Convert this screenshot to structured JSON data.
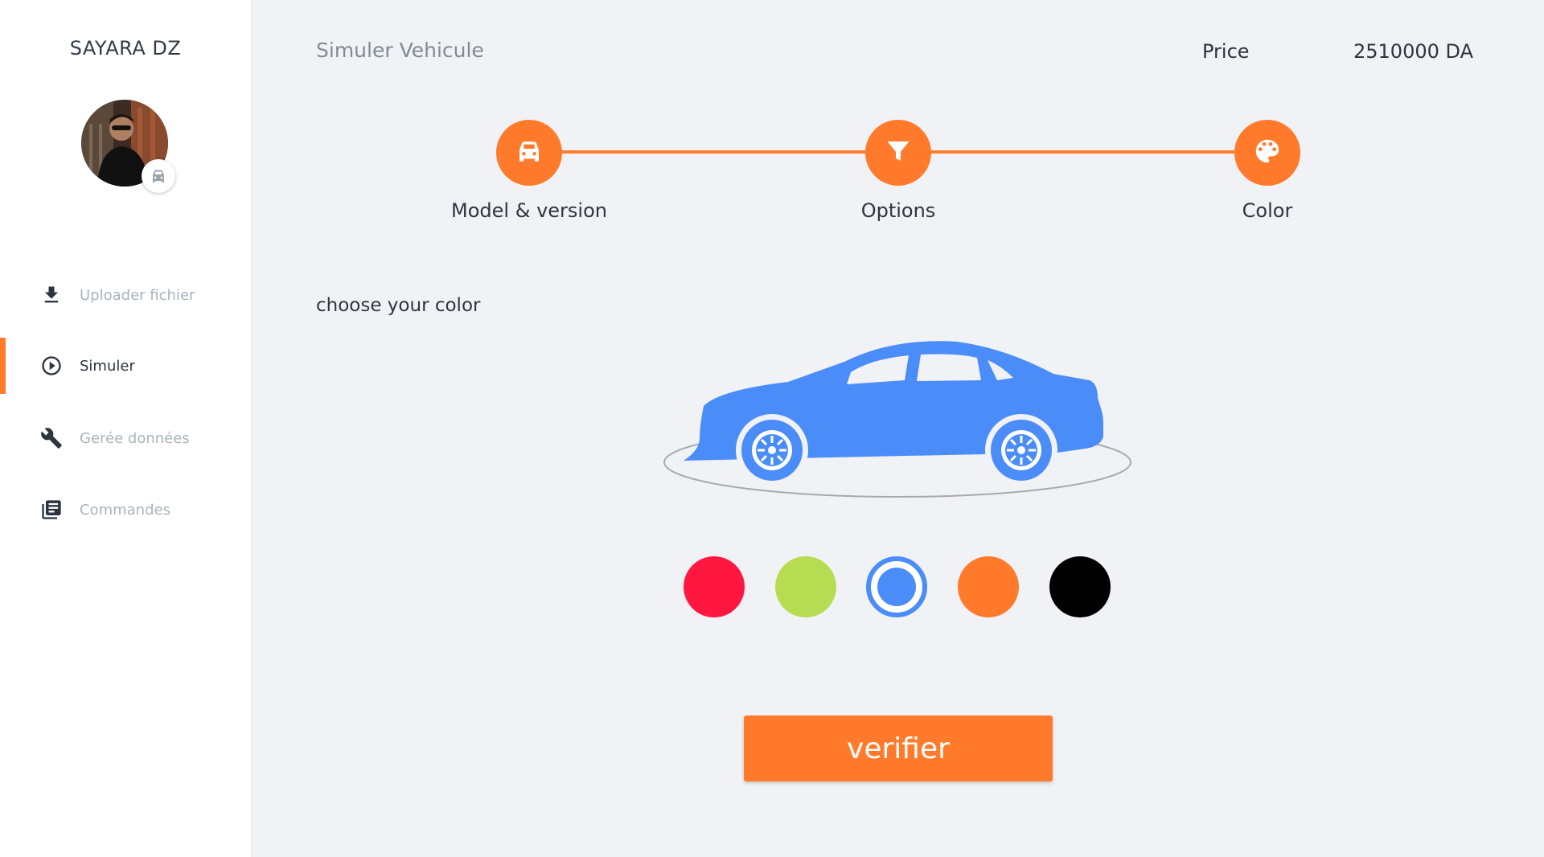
{
  "app": {
    "brand": "SAYARA DZ"
  },
  "sidebar": {
    "items": [
      {
        "label": "Uploader fichier",
        "icon": "download-icon",
        "active": false
      },
      {
        "label": "Simuler",
        "icon": "play-circle-icon",
        "active": true
      },
      {
        "label": "Gerée données",
        "icon": "wrench-icon",
        "active": false
      },
      {
        "label": "Commandes",
        "icon": "library-icon",
        "active": false
      }
    ]
  },
  "header": {
    "title": "Simuler Vehicule",
    "price_label": "Price",
    "price_value": "2510000 DA"
  },
  "stepper": {
    "steps": [
      {
        "label": "Model & version",
        "icon": "car-icon"
      },
      {
        "label": "Options",
        "icon": "filter-icon"
      },
      {
        "label": "Color",
        "icon": "palette-icon"
      }
    ]
  },
  "main": {
    "section_label": "choose your color",
    "colors": [
      {
        "name": "red",
        "hex": "#ff1740",
        "selected": false
      },
      {
        "name": "lime",
        "hex": "#b6dc52",
        "selected": false
      },
      {
        "name": "blue",
        "hex": "#4b8df8",
        "selected": true
      },
      {
        "name": "orange",
        "hex": "#ff7a2b",
        "selected": false
      },
      {
        "name": "black",
        "hex": "#000000",
        "selected": false
      }
    ],
    "car_color": "#4b8df8",
    "verify_label": "verifier"
  },
  "theme": {
    "accent": "#ff7a2b",
    "sidebar_bg": "#ffffff",
    "page_bg": "#f1f2f5"
  }
}
